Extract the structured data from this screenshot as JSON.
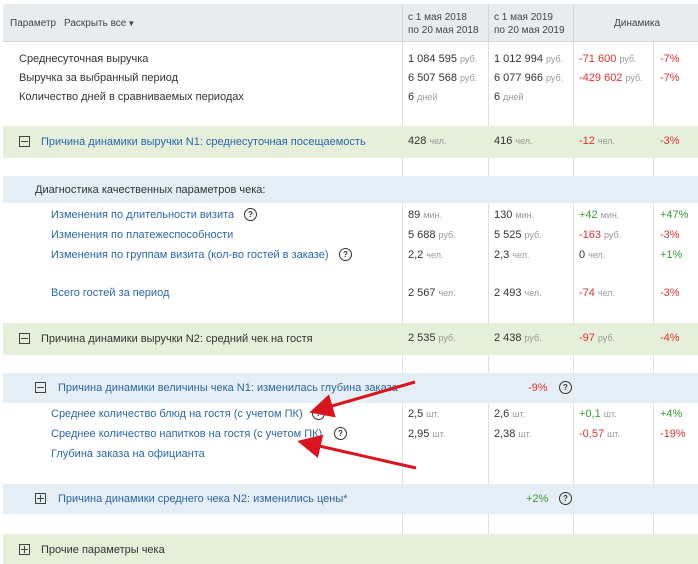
{
  "header": {
    "param_label": "Параметр",
    "expand_all": "Раскрыть все",
    "period1_line1": "с 1 мая 2018",
    "period1_line2": "по 20 мая 2018",
    "period2_line1": "с 1 мая 2019",
    "period2_line2": "по 20 мая 2019",
    "dynamics": "Динамика"
  },
  "summary_rows": [
    {
      "label": "Среднесуточная выручка",
      "v1": "1 084 595",
      "u1": "руб.",
      "v2": "1 012 994",
      "u2": "руб.",
      "d": "-71 600",
      "du": "руб.",
      "p": "-7%"
    },
    {
      "label": "Выручка за выбранный период",
      "v1": "6 507 568",
      "u1": "руб.",
      "v2": "6 077 966",
      "u2": "руб.",
      "d": "-429 602",
      "du": "руб.",
      "p": "-7%"
    },
    {
      "label": "Количество дней в сравниваемых периодах",
      "v1": "6",
      "u1": "дней",
      "v2": "6",
      "u2": "дней"
    }
  ],
  "reason1": {
    "label": "Причина динамики выручки N1: среднесуточная посещаемость",
    "v1": "428",
    "u1": "чел.",
    "v2": "416",
    "u2": "чел.",
    "d": "-12",
    "du": "чел.",
    "p": "-3%"
  },
  "diagnostics_title": "Диагностика качественных параметров чека:",
  "diag_rows": [
    {
      "label": "Изменения по длительности визита",
      "v1": "89",
      "u1": "мин.",
      "v2": "130",
      "u2": "мин.",
      "d": "+42",
      "du": "мин.",
      "p": "+47%"
    },
    {
      "label": "Изменения по платежеспособности",
      "v1": "5 688",
      "u1": "руб.",
      "v2": "5 525",
      "u2": "руб.",
      "d": "-163",
      "du": "руб.",
      "p": "-3%"
    },
    {
      "label": "Изменения по группам визита (кол-во гостей в заказе)",
      "v1": "2,2",
      "u1": "чел.",
      "v2": "2,3",
      "u2": "чел.",
      "d": "0",
      "du": "чел.",
      "p": "+1%"
    }
  ],
  "total_guests": {
    "label": "Всего гостей за период",
    "v1": "2 567",
    "u1": "чел.",
    "v2": "2 493",
    "u2": "чел.",
    "d": "-74",
    "du": "чел.",
    "p": "-3%"
  },
  "reason2": {
    "label": "Причина динамики выручки N2: средний чек на гостя",
    "v1": "2 535",
    "u1": "руб.",
    "v2": "2 438",
    "u2": "руб.",
    "d": "-97",
    "du": "руб.",
    "p": "-4%"
  },
  "check_reason1": {
    "label": "Причина динамики величины чека N1: изменилась глубина заказа",
    "p": "-9%"
  },
  "depth_rows": [
    {
      "label": "Среднее количество блюд на гостя (с учетом ПК)",
      "v1": "2,5",
      "u1": "шт.",
      "v2": "2,6",
      "u2": "шт.",
      "d": "+0,1",
      "du": "шт.",
      "p": "+4%"
    },
    {
      "label": "Среднее количество напитков на гостя (с учетом ПК)",
      "v1": "2,95",
      "u1": "шт.",
      "v2": "2,38",
      "u2": "шт.",
      "d": "-0,57",
      "du": "шт.",
      "p": "-19%"
    },
    {
      "label": "Глубина заказа на официанта"
    }
  ],
  "check_reason2": {
    "label": "Причина динамики среднего чека N2: изменились цены*",
    "p": "+2%"
  },
  "other_params": "Прочие параметры чека",
  "icons": {
    "help": "?",
    "dropdown": "▼"
  }
}
